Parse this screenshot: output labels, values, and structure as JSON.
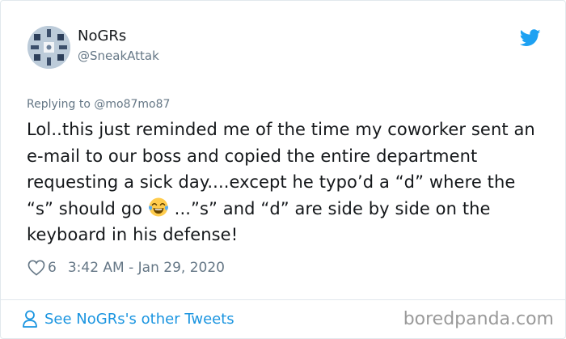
{
  "author": {
    "display_name": "NoGRs",
    "handle": "@SneakAttak"
  },
  "reply": {
    "prefix": "Replying to ",
    "mention": "@mo87mo87"
  },
  "tweet": {
    "text_before_emoji": "Lol..this just reminded me of the time my coworker sent an e-mail to our boss and copied the entire department requesting a sick day....except he typo’d a “d” where the “s” should go ",
    "emoji": "face-with-tears-of-joy",
    "text_after_emoji": " ...”s” and “d” are side by side on the keyboard in his defense!"
  },
  "meta": {
    "likes": "6",
    "timestamp": "3:42 AM - Jan 29, 2020"
  },
  "footer": {
    "link_label": "See NoGRs's other Tweets"
  },
  "watermark": "boredpanda.com",
  "icons": {
    "brand": "twitter-bird-icon",
    "like": "heart-icon",
    "profile": "person-icon"
  },
  "colors": {
    "twitter_blue": "#1da1f2",
    "link_blue": "#1b95e0",
    "muted": "#657786",
    "text": "#14171a"
  }
}
